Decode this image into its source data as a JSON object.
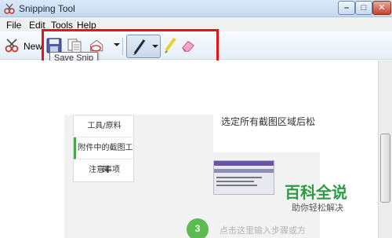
{
  "window": {
    "title": "Snipping Tool"
  },
  "menu": {
    "items": [
      "File",
      "Edit",
      "Tools",
      "Help"
    ]
  },
  "toolbar": {
    "new_label": "New",
    "tooltip": "Save Snip",
    "highlight_color": "#e3151a"
  },
  "captured": {
    "nav_items": [
      "工具/原料",
      "附件中的截图工具",
      "注意事项"
    ],
    "content_text": "选定所有截图区域后松",
    "watermark_main": "百科全说",
    "watermark_sub": "助你轻松解决",
    "step_number": "3",
    "bottom_text": "点击这里输入步骤或方"
  }
}
